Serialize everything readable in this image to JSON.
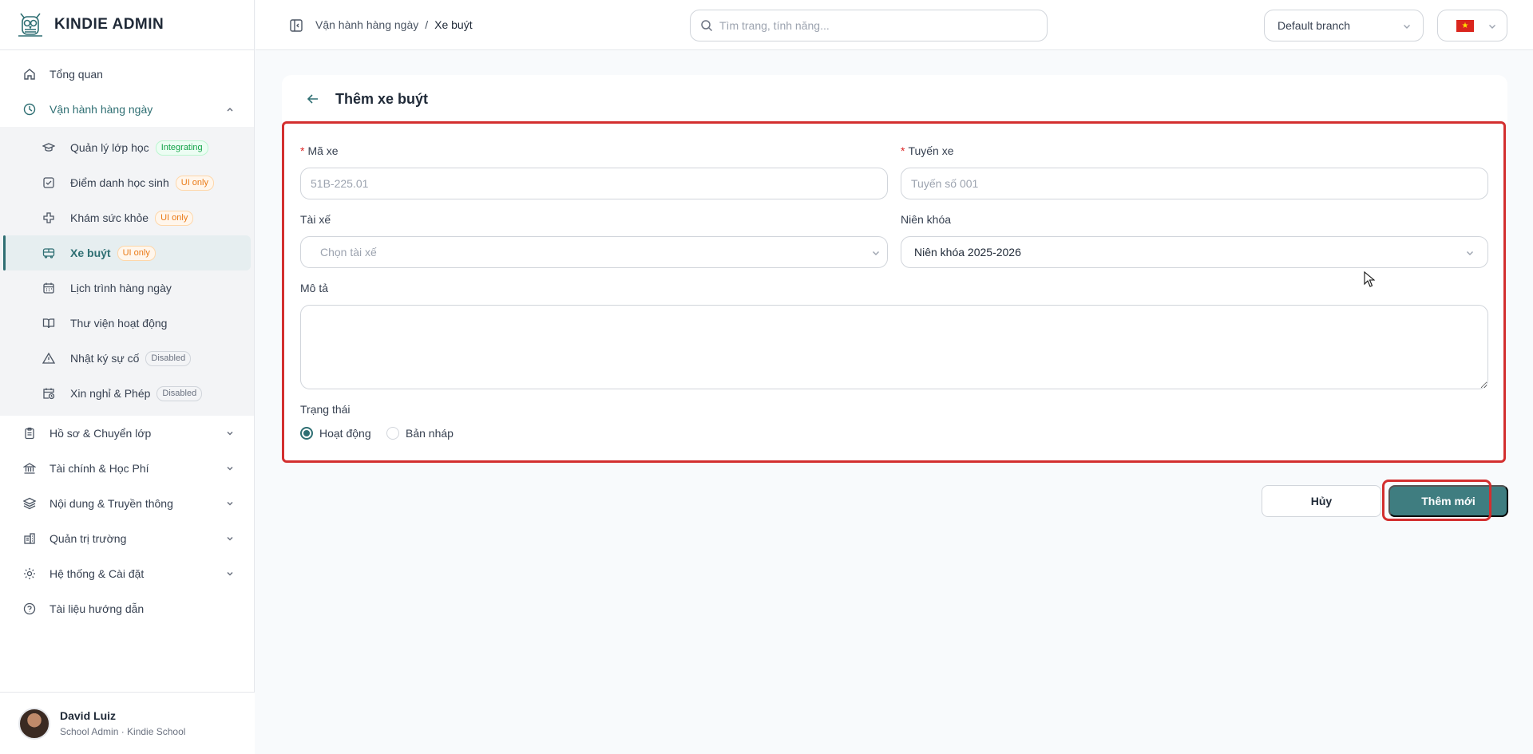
{
  "app": {
    "title": "KINDIE ADMIN"
  },
  "sidebar": {
    "items": [
      {
        "label": "Tổng quan",
        "icon": "home-icon"
      },
      {
        "label": "Vận hành hàng ngày",
        "icon": "clock-icon",
        "expanded": true,
        "children": [
          {
            "label": "Quản lý lớp học",
            "icon": "graduation-cap-icon",
            "badge": "Integrating",
            "badge_color": "green"
          },
          {
            "label": "Điểm danh học sinh",
            "icon": "checkbox-icon",
            "badge": "UI only",
            "badge_color": "orange"
          },
          {
            "label": "Khám sức khỏe",
            "icon": "medical-cross-icon",
            "badge": "UI only",
            "badge_color": "orange"
          },
          {
            "label": "Xe buýt",
            "icon": "bus-icon",
            "badge": "UI only",
            "badge_color": "orange",
            "active": true
          },
          {
            "label": "Lịch trình hàng ngày",
            "icon": "calendar-icon"
          },
          {
            "label": "Thư viện hoạt động",
            "icon": "book-icon"
          },
          {
            "label": "Nhật ký sự cố",
            "icon": "warning-icon",
            "badge": "Disabled",
            "badge_color": "gray"
          },
          {
            "label": "Xin nghỉ & Phép",
            "icon": "calendar-clock-icon",
            "badge": "Disabled",
            "badge_color": "gray"
          }
        ]
      },
      {
        "label": "Hồ sơ & Chuyển lớp",
        "icon": "clipboard-icon"
      },
      {
        "label": "Tài chính & Học Phí",
        "icon": "bank-icon"
      },
      {
        "label": "Nội dung & Truyền thông",
        "icon": "layers-icon"
      },
      {
        "label": "Quản trị trường",
        "icon": "building-icon"
      },
      {
        "label": "Hệ thống & Cài đặt",
        "icon": "gear-icon"
      },
      {
        "label": "Tài liệu hướng dẫn",
        "icon": "help-circle-icon"
      }
    ],
    "user": {
      "name": "David Luiz",
      "role": "School Admin · Kindie School"
    }
  },
  "topbar": {
    "breadcrumb": [
      "Vận hành hàng ngày",
      "/",
      "Xe buýt"
    ],
    "search_placeholder": "Tìm trang, tính năng...",
    "branch": "Default branch",
    "language_flag": "vietnam-flag-icon"
  },
  "page": {
    "title": "Thêm xe buýt",
    "form": {
      "bus_code": {
        "label": "Mã xe",
        "placeholder": "51B-225.01",
        "value": ""
      },
      "route": {
        "label": "Tuyến xe",
        "placeholder": "Tuyến số 001",
        "value": ""
      },
      "driver": {
        "label": "Tài xế",
        "placeholder": "Chọn tài xế"
      },
      "school_year": {
        "label": "Niên khóa",
        "value": "Niên khóa 2025-2026"
      },
      "description": {
        "label": "Mô tả",
        "value": ""
      },
      "status": {
        "label": "Trạng thái",
        "options": [
          "Hoạt động",
          "Bản nháp"
        ],
        "selected": "Hoạt động"
      }
    },
    "actions": {
      "cancel": "Hủy",
      "submit": "Thêm mới"
    }
  },
  "colors": {
    "accent": "#2f6f73",
    "primary_button": "#3f7d80",
    "highlight": "#d32f2f"
  }
}
